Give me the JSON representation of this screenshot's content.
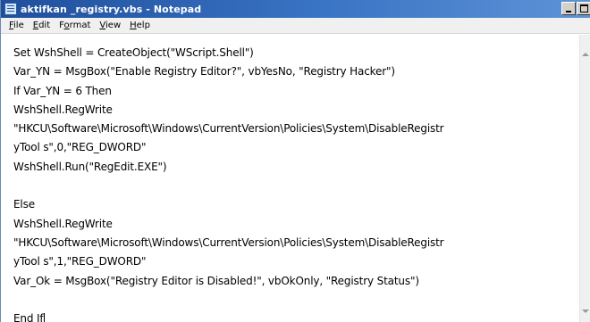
{
  "window": {
    "title": "aktifkan _registry.vbs - Notepad",
    "app_icon": "notepad-icon"
  },
  "menu": {
    "items": [
      {
        "label": "File",
        "accel": "F",
        "rest": "ile"
      },
      {
        "label": "Edit",
        "accel": "E",
        "rest": "dit"
      },
      {
        "label": "Format",
        "accel": "o",
        "pre": "F",
        "rest": "rmat"
      },
      {
        "label": "View",
        "accel": "V",
        "rest": "iew"
      },
      {
        "label": "Help",
        "accel": "H",
        "rest": "elp"
      }
    ]
  },
  "editor": {
    "lines": [
      "Set WshShell = CreateObject(\"WScript.Shell\")",
      "Var_YN = MsgBox(\"Enable Registry Editor?\", vbYesNo, \"Registry Hacker\")",
      "If Var_YN = 6 Then",
      "WshShell.RegWrite",
      "\"HKCU\\Software\\Microsoft\\Windows\\CurrentVersion\\Policies\\System\\DisableRegistr",
      "yTool s\",0,\"REG_DWORD\"",
      "WshShell.Run(\"RegEdit.EXE\")",
      "",
      "Else",
      "WshShell.RegWrite",
      "\"HKCU\\Software\\Microsoft\\Windows\\CurrentVersion\\Policies\\System\\DisableRegistr",
      "yTool s\",1,\"REG_DWORD\"",
      "Var_Ok = MsgBox(\"Registry Editor is Disabled!\", vbOkOnly, \"Registry Status\")",
      "",
      "End If"
    ]
  },
  "colors": {
    "titlebar_start": "#1f4f9c",
    "titlebar_end": "#5e93d6",
    "menubar_bg": "#f0f0f0",
    "editor_bg": "#ffffff"
  }
}
